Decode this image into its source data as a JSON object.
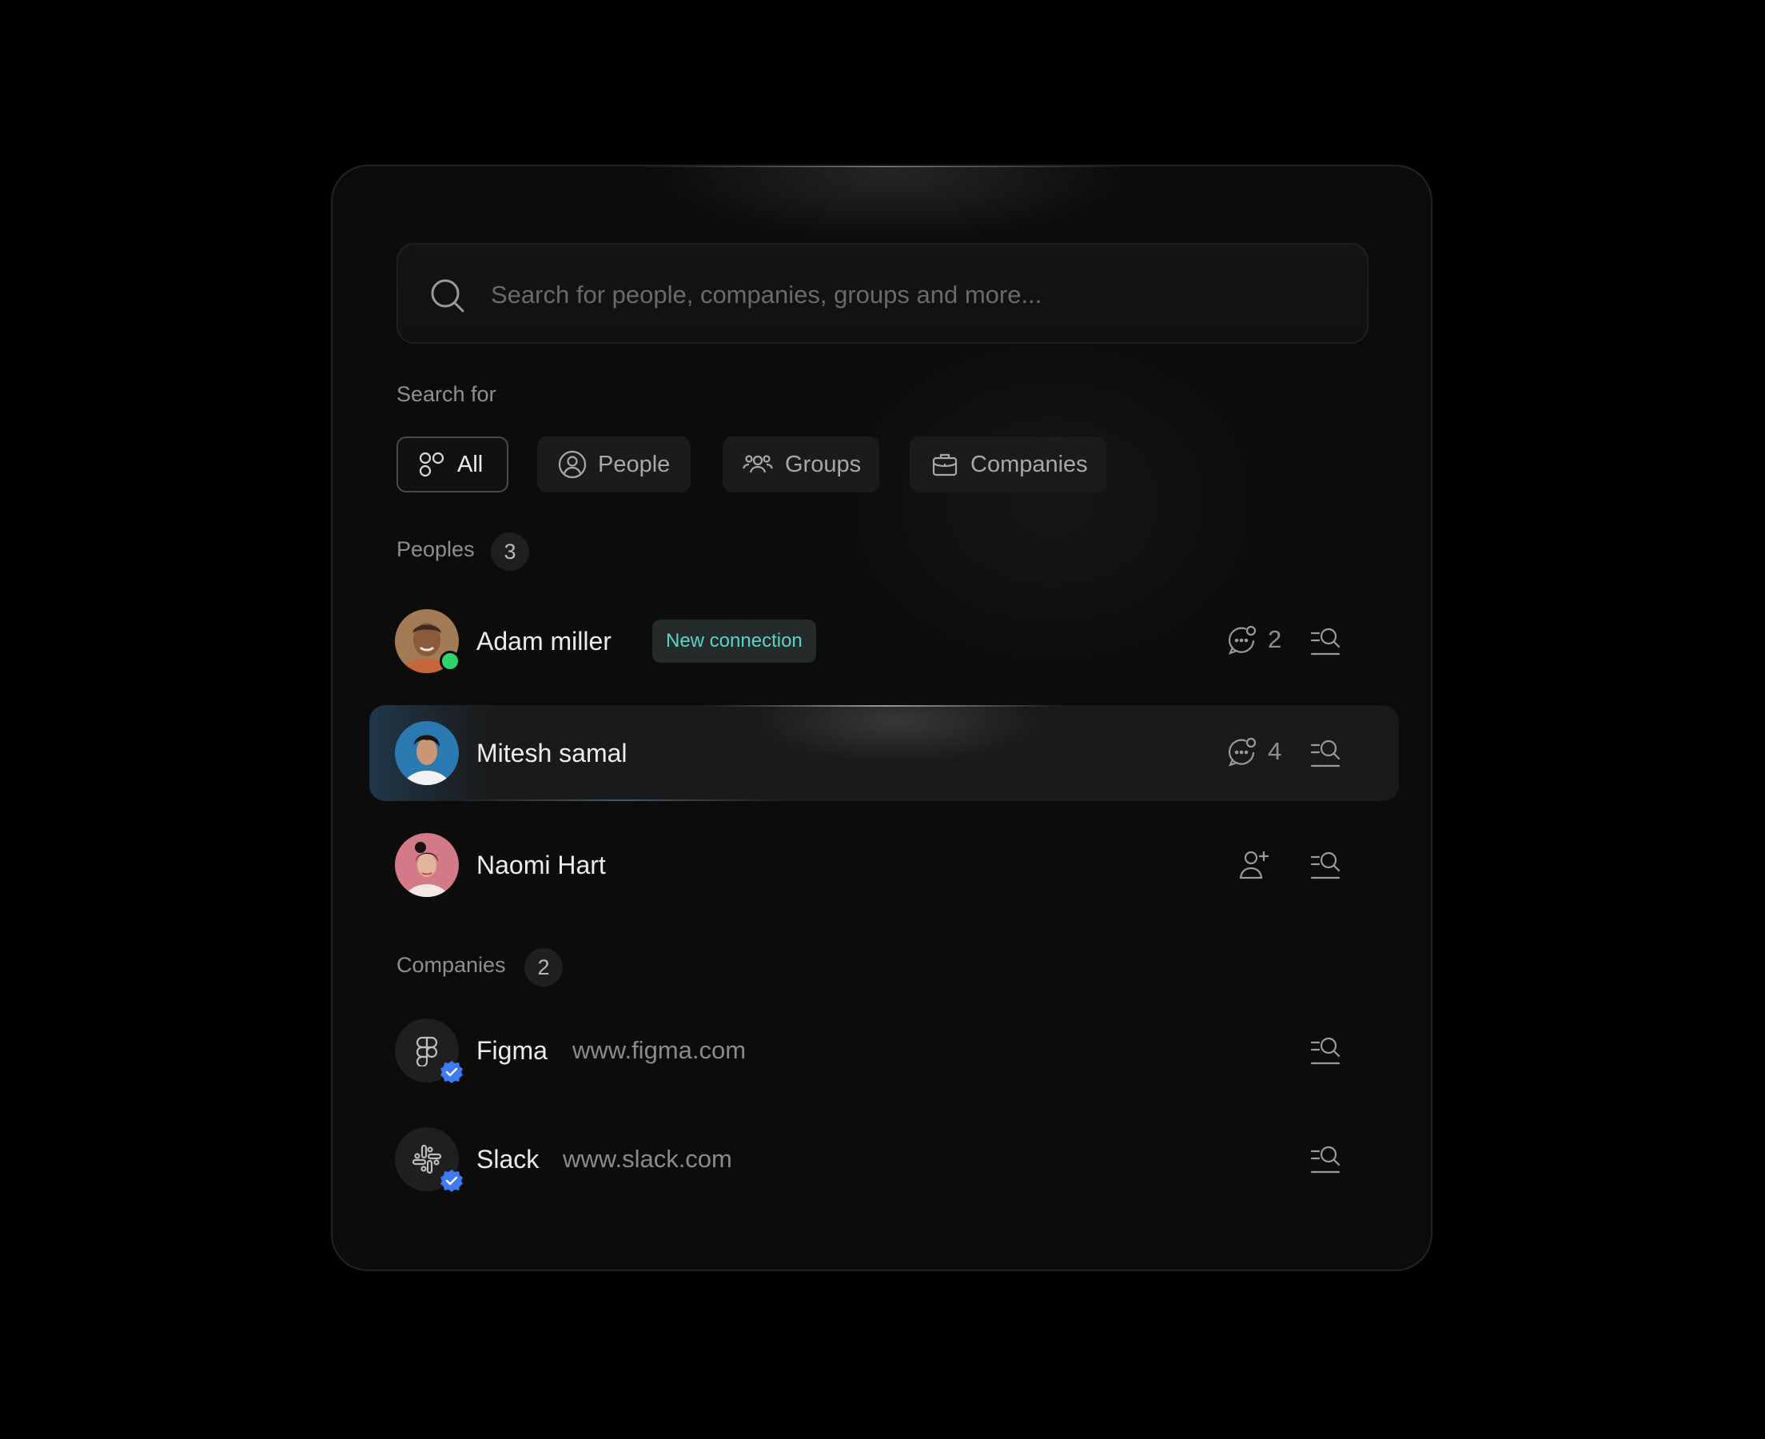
{
  "search": {
    "placeholder": "Search for people, companies, groups and more..."
  },
  "filters": {
    "label": "Search for",
    "chips": [
      {
        "label": "All",
        "icon": "all-icon",
        "active": true
      },
      {
        "label": "People",
        "icon": "person-icon",
        "active": false
      },
      {
        "label": "Groups",
        "icon": "groups-icon",
        "active": false
      },
      {
        "label": "Companies",
        "icon": "briefcase-icon",
        "active": false
      }
    ]
  },
  "people": {
    "label": "Peoples",
    "count": "3",
    "items": [
      {
        "name": "Adam miller",
        "tag": "New connection",
        "online": true,
        "messages": "2",
        "action": "chat-icon"
      },
      {
        "name": "Mitesh samal",
        "messages": "4",
        "highlighted": true,
        "action": "chat-icon"
      },
      {
        "name": "Naomi Hart",
        "action": "add-user-icon"
      }
    ]
  },
  "companies": {
    "label": "Companies",
    "count": "2",
    "items": [
      {
        "name": "Figma",
        "url": "www.figma.com",
        "icon": "figma-logo-icon",
        "verified": true
      },
      {
        "name": "Slack",
        "url": "www.slack.com",
        "icon": "slack-logo-icon",
        "verified": true
      }
    ]
  },
  "colors": {
    "background": "#000000",
    "panel": "#0c0c0c",
    "tag_text": "#5dd4c4",
    "online": "#2fd36a",
    "verified": "#3d7bf0"
  }
}
